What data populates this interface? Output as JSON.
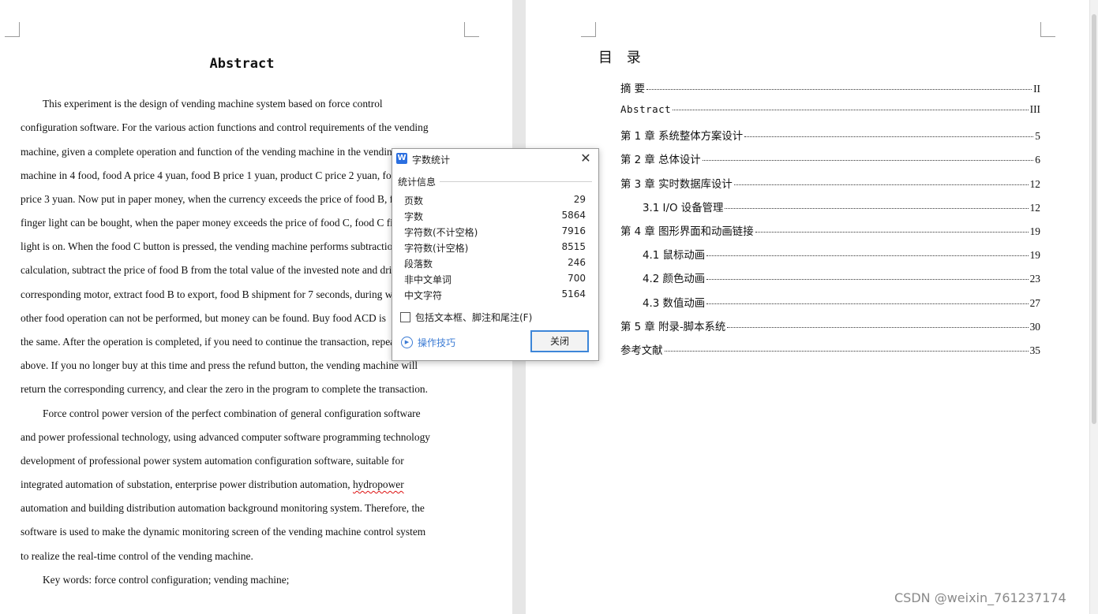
{
  "left_page": {
    "title": "Abstract",
    "lines": [
      "This experiment is the design of vending machine system based on force control",
      "configuration software. For the various action functions and control requirements of the vending",
      "machine, given a complete operation and function of the vending machine in the vending",
      "machine in 4 food, food A price 4 yuan, food B price 1 yuan, product C price 2 yuan, food D",
      "price 3 yuan. Now put in paper money, when the currency exceeds the price of food B, food B",
      "finger light can be bought, when the paper money exceeds the price of food C, food C finger",
      "light is on. When the food C button is pressed, the vending machine performs subtraction",
      "calculation, subtract the price of food B from the total value of the invested note and drive the",
      "corresponding motor, extract food B to export, food B shipment for 7 seconds, during which",
      "other food operation can not be performed, but money can be found. Buy food ACD is",
      "the same. After the operation is completed, if you need to continue the transaction, repeat the",
      "above. If you no longer buy at this time and press the refund button, the vending machine will",
      "return the corresponding currency, and clear the zero in the program to complete the transaction.",
      "Force control power version of the perfect combination of general configuration software",
      "and power professional technology, using advanced computer software programming technology",
      "development of professional power system automation configuration software, suitable for",
      "integrated automation of substation, enterprise power distribution automation, ",
      "automation and building distribution automation background monitoring system. Therefore, the",
      "software is used to make the dynamic monitoring screen of the vending machine control system",
      "to realize the real-time control of the vending machine.",
      "Key words: force control configuration; vending machine;"
    ],
    "misspelled_word": "hydropower"
  },
  "toc": {
    "title": "目 录",
    "entries": [
      {
        "label": "摘  要",
        "page": "II"
      },
      {
        "label": "Abstract",
        "page": "III"
      },
      {
        "label": "第 1 章  系统整体方案设计",
        "page": "5"
      },
      {
        "label": "第 2 章  总体设计",
        "page": "6"
      },
      {
        "label": "第 3 章  实时数据库设计",
        "page": "12"
      },
      {
        "label": "3.1 I/O 设备管理",
        "page": "12"
      },
      {
        "label": "第 4 章  图形界面和动画链接",
        "page": "19"
      },
      {
        "label": "4.1  鼠标动画",
        "page": "19"
      },
      {
        "label": "4.2  颜色动画",
        "page": "23"
      },
      {
        "label": "4.3  数值动画",
        "page": "27"
      },
      {
        "label": "第 5 章  附录-脚本系统",
        "page": "30"
      },
      {
        "label": "参考文献",
        "page": "35"
      }
    ]
  },
  "dialog": {
    "app_icon": "W",
    "title": "字数统计",
    "group_label": "统计信息",
    "stats": [
      {
        "label": "页数",
        "value": "29"
      },
      {
        "label": "字数",
        "value": "5864"
      },
      {
        "label": "字符数(不计空格)",
        "value": "7916"
      },
      {
        "label": "字符数(计空格)",
        "value": "8515"
      },
      {
        "label": "段落数",
        "value": "246"
      },
      {
        "label": "非中文单词",
        "value": "700"
      },
      {
        "label": "中文字符",
        "value": "5164"
      }
    ],
    "checkbox_label": "包括文本框、脚注和尾注(F)",
    "checkbox_checked": false,
    "tips_label": "操作技巧",
    "close_label": "关闭"
  },
  "watermark": "CSDN @weixin_761237174",
  "colors": {
    "accent": "#3d86d8",
    "link": "#3b7bd4",
    "page_background": "#ffffff",
    "workspace": "#e9e9e9"
  }
}
